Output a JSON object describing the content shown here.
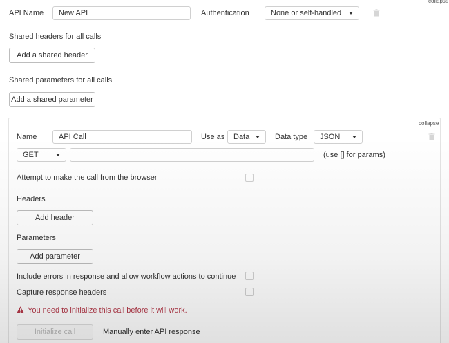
{
  "top": {
    "collapse_label": "collapse",
    "api_name_label": "API Name",
    "api_name_value": "New API",
    "authentication_label": "Authentication",
    "authentication_value": "None or self-handled"
  },
  "shared_headers": {
    "title": "Shared headers for all calls",
    "button": "Add a shared header"
  },
  "shared_parameters": {
    "title": "Shared parameters for all calls",
    "button": "Add a shared parameter"
  },
  "call": {
    "collapse_label": "collapse",
    "name_label": "Name",
    "name_value": "API Call",
    "use_as_label": "Use as",
    "use_as_value": "Data",
    "data_type_label": "Data type",
    "data_type_value": "JSON",
    "method_value": "GET",
    "url_value": "",
    "url_hint": "(use [] for params)",
    "browser_call_label": "Attempt to make the call from the browser",
    "headers_title": "Headers",
    "add_header_button": "Add header",
    "parameters_title": "Parameters",
    "add_parameter_button": "Add parameter",
    "include_errors_label": "Include errors in response and allow workflow actions to continue",
    "capture_headers_label": "Capture response headers",
    "warning_text": "You need to initialize this call before it will work.",
    "initialize_button": "Initialize call",
    "manual_response_link": "Manually enter API response"
  },
  "colors": {
    "warning": "#b53a4a",
    "border": "#d0d0d0"
  }
}
